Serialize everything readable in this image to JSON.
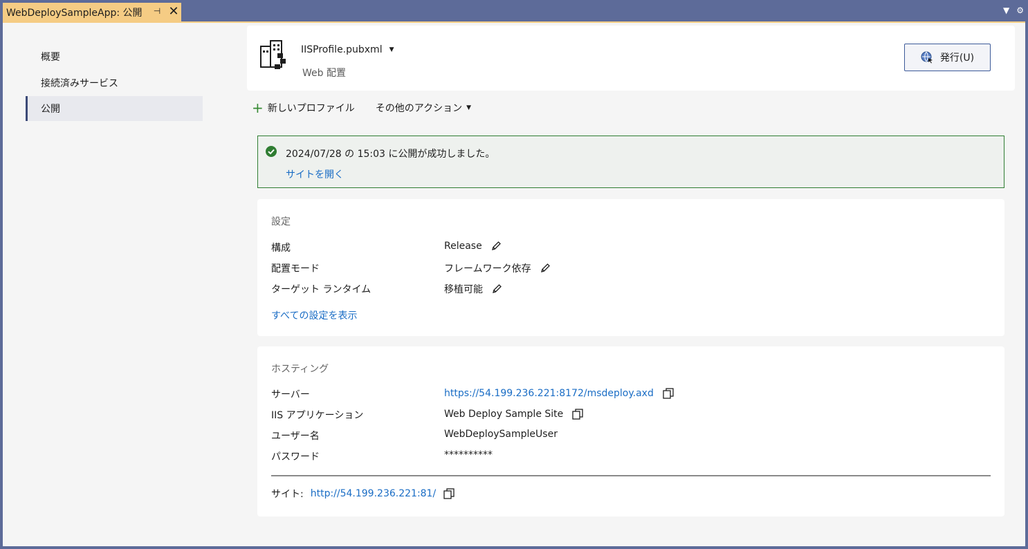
{
  "tab": {
    "title": "WebDeploySampleApp: 公開",
    "pin_icon": "pin-icon",
    "close_icon": "close-icon"
  },
  "sidebar": {
    "items": [
      {
        "label": "概要"
      },
      {
        "label": "接続済みサービス"
      },
      {
        "label": "公開"
      }
    ]
  },
  "profile": {
    "name": "IISProfile.pubxml",
    "type": "Web 配置",
    "publish_label": "発行(U)"
  },
  "toolbar": {
    "new_profile": "新しいプロファイル",
    "more_actions": "その他のアクション"
  },
  "banner": {
    "message": "2024/07/28 の 15:03 に公開が成功しました。",
    "open_site": "サイトを開く"
  },
  "settings": {
    "title": "設定",
    "rows": [
      {
        "label": "構成",
        "value": "Release"
      },
      {
        "label": "配置モード",
        "value": "フレームワーク依存"
      },
      {
        "label": "ターゲット ランタイム",
        "value": "移植可能"
      }
    ],
    "show_all": "すべての設定を表示"
  },
  "hosting": {
    "title": "ホスティング",
    "rows": [
      {
        "label": "サーバー",
        "value": "https://54.199.236.221:8172/msdeploy.axd"
      },
      {
        "label": "IIS アプリケーション",
        "value": "Web Deploy Sample Site"
      },
      {
        "label": "ユーザー名",
        "value": "WebDeploySampleUser"
      },
      {
        "label": "パスワード",
        "value": "**********"
      }
    ],
    "site_label": "サイト:",
    "site_url": "http://54.199.236.221:81/"
  },
  "colors": {
    "tab_accent": "#f5cc84",
    "frame": "#5d6b99",
    "link": "#1a6dc5",
    "success": "#2f7d32"
  }
}
